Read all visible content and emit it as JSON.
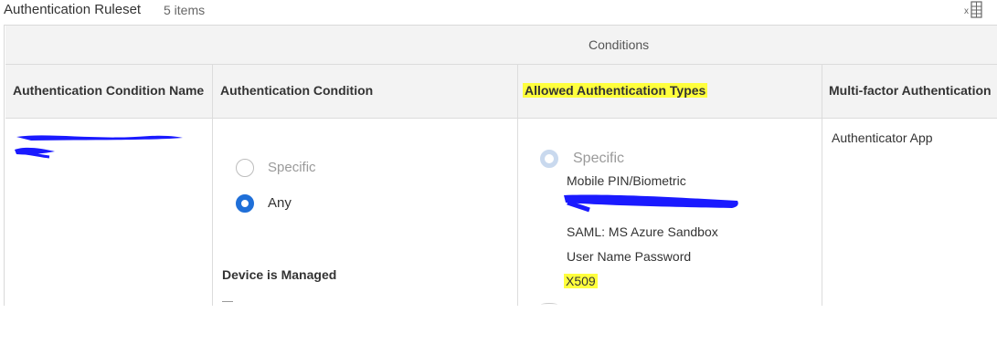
{
  "header": {
    "title": "Authentication Ruleset",
    "count": "5 items"
  },
  "toolbar": {
    "export_icon": "excel-export-icon"
  },
  "table": {
    "group_header": "Conditions",
    "columns": [
      "Authentication Condition Name",
      "Authentication Condition",
      "Allowed Authentication Types",
      "Multi-factor Authentication"
    ],
    "row": {
      "condition_options": {
        "specific": "Specific",
        "any": "Any",
        "selected": "Any"
      },
      "device_label": "Device is Managed",
      "allowed_types": {
        "mode_label": "Specific",
        "items": [
          "Mobile PIN/Biometric",
          "SAML: MS Azure Sandbox",
          "User Name Password",
          "X509"
        ]
      },
      "mfa": "Authenticator App"
    }
  },
  "colors": {
    "highlight": "#ffff3d",
    "accent": "#1f6fd8",
    "redaction": "#1a1aff"
  }
}
